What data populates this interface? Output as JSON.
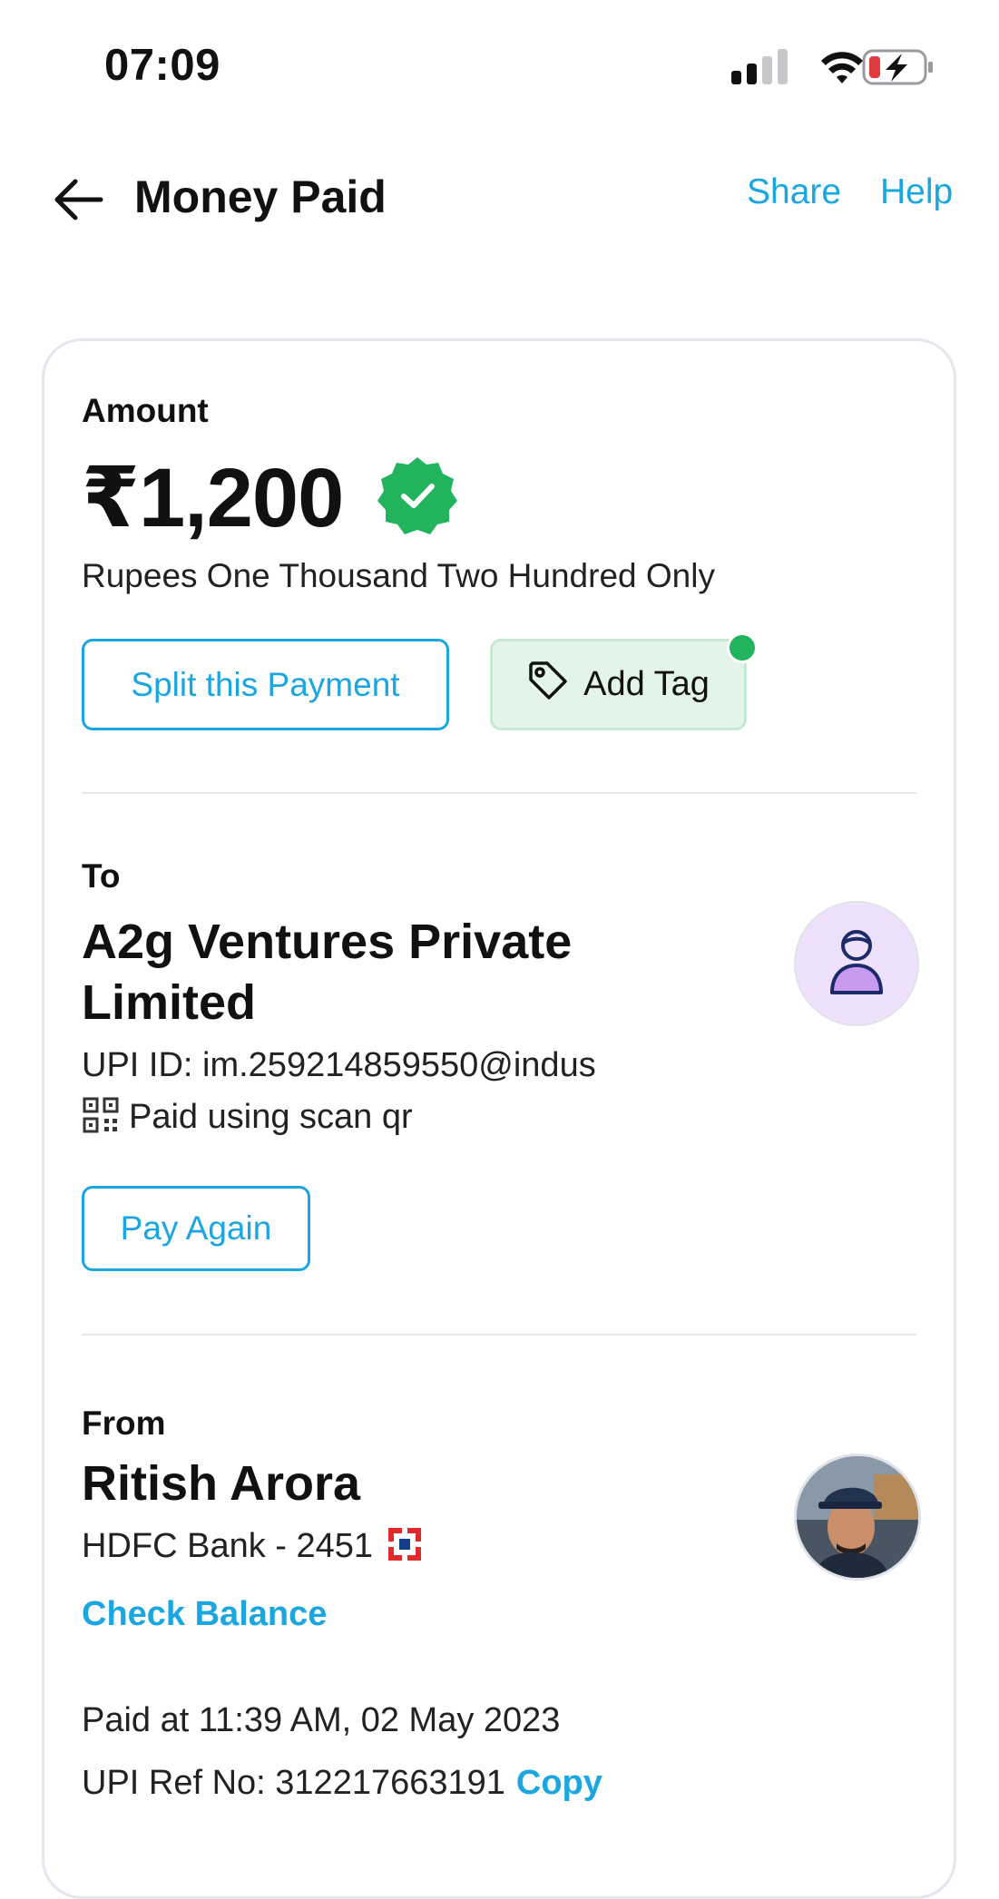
{
  "status_bar": {
    "time": "07:09"
  },
  "header": {
    "title": "Money Paid",
    "share_label": "Share",
    "help_label": "Help"
  },
  "amount": {
    "label": "Amount",
    "value": "₹1,200",
    "in_words": "Rupees One Thousand Two Hundred Only",
    "split_button": "Split this Payment",
    "add_tag_button": "Add Tag"
  },
  "to": {
    "label": "To",
    "name_line1": "A2g Ventures Private",
    "name_line2": "Limited",
    "upi_id": "UPI ID: im.259214859550@indus",
    "method": "Paid using scan qr",
    "pay_again": "Pay Again"
  },
  "from": {
    "label": "From",
    "name": "Ritish Arora",
    "bank": "HDFC Bank - 2451",
    "check_balance": "Check Balance"
  },
  "details": {
    "paid_at": "Paid at 11:39 AM, 02 May 2023",
    "upi_ref": "UPI Ref No: 312217663191",
    "copy_label": "Copy"
  },
  "colors": {
    "accent": "#1aa6e0",
    "verified": "#21b45d",
    "tag_bg": "#e3f5e9",
    "avatar_bg": "#efe1fb"
  }
}
